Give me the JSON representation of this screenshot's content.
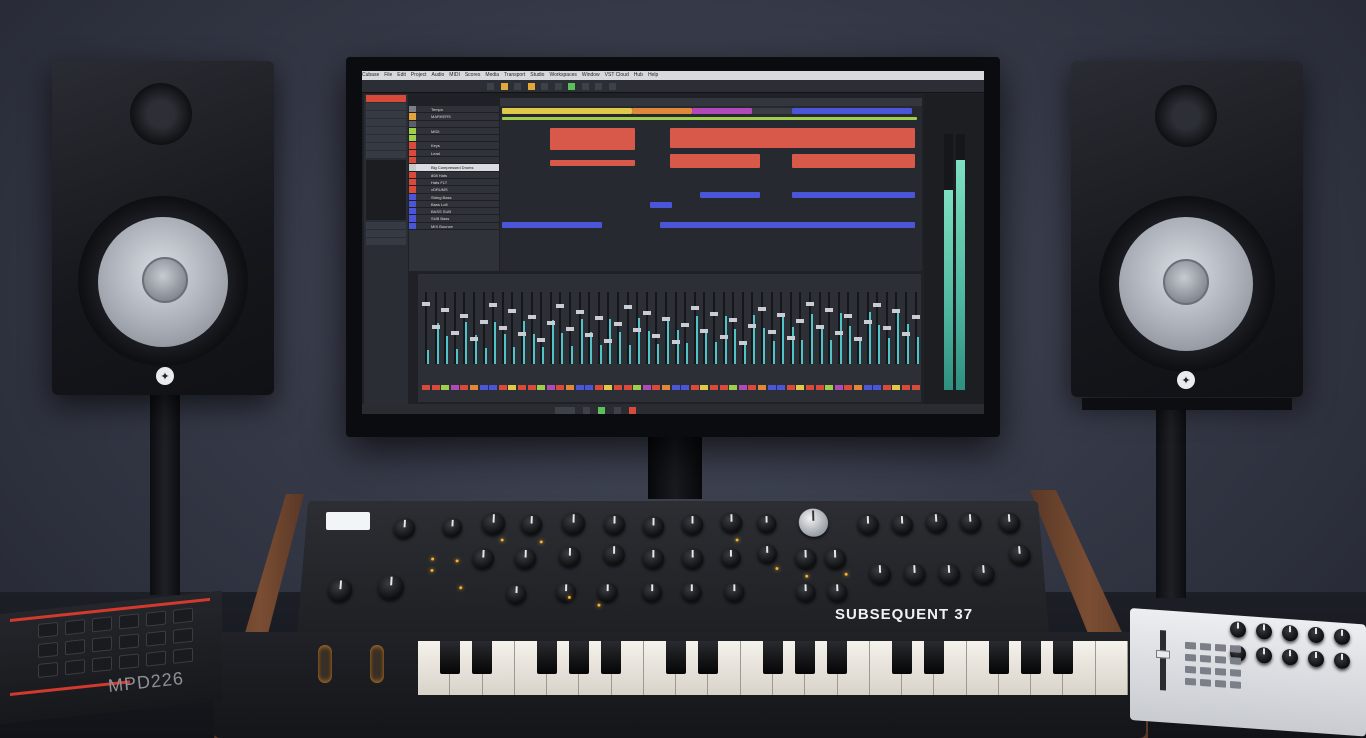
{
  "daw": {
    "menu": [
      "Cubase",
      "File",
      "Edit",
      "Project",
      "Audio",
      "MIDI",
      "Scores",
      "Media",
      "Transport",
      "Studio",
      "Workspaces",
      "Window",
      "VST Cloud",
      "Hub",
      "Help"
    ],
    "tracks": [
      {
        "name": "Tempo",
        "color": "#7a7f88"
      },
      {
        "name": "MARKERS",
        "color": "#e8a23a"
      },
      {
        "name": "",
        "color": "#5a5e66"
      },
      {
        "name": "MIDI",
        "color": "#9fcf4a"
      },
      {
        "name": "",
        "color": "#9fcf4a"
      },
      {
        "name": "Keys",
        "color": "#d84a3a"
      },
      {
        "name": "Lead",
        "color": "#d84a3a"
      },
      {
        "name": "",
        "color": "#d84a3a"
      },
      {
        "name": "Big Compressed Drums",
        "color": "#c8c8c8"
      },
      {
        "name": "808 Hats",
        "color": "#d84a3a"
      },
      {
        "name": "Hats FLT",
        "color": "#d84a3a"
      },
      {
        "name": "vDRUMS",
        "color": "#d84a3a"
      },
      {
        "name": "String Bass",
        "color": "#4a55d8"
      },
      {
        "name": "Bass Lofi",
        "color": "#4a55d8"
      },
      {
        "name": "BASS SUB",
        "color": "#4a55d8"
      },
      {
        "name": "SUB Bass",
        "color": "#4a55d8"
      },
      {
        "name": "MIX Bounce",
        "color": "#4a55d8"
      }
    ]
  },
  "synth": {
    "brand_word": "SUBSEQUENT 37"
  },
  "pad_controller": {
    "model": "MPD226"
  }
}
